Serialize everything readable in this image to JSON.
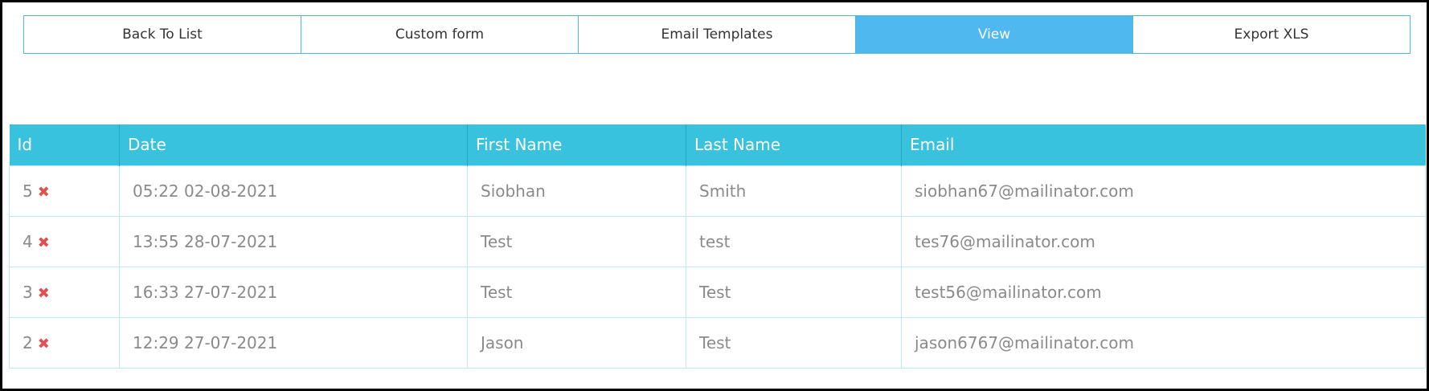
{
  "tabs": [
    {
      "label": "Back To List"
    },
    {
      "label": "Custom form"
    },
    {
      "label": "Email Templates"
    },
    {
      "label": "View",
      "active": true
    },
    {
      "label": "Export XLS"
    }
  ],
  "table": {
    "headers": [
      "Id",
      "Date",
      "First Name",
      "Last Name",
      "Email"
    ],
    "rows": [
      {
        "id": "5",
        "date": "05:22 02-08-2021",
        "first": "Siobhan",
        "last": "Smith",
        "email": "siobhan67@mailinator.com"
      },
      {
        "id": "4",
        "date": "13:55 28-07-2021",
        "first": "Test",
        "last": "test",
        "email": "tes76@mailinator.com"
      },
      {
        "id": "3",
        "date": "16:33 27-07-2021",
        "first": "Test",
        "last": "Test",
        "email": "test56@mailinator.com"
      },
      {
        "id": "2",
        "date": "12:29 27-07-2021",
        "first": "Jason",
        "last": "Test",
        "email": "jason6767@mailinator.com"
      }
    ],
    "delete_icon": "close-icon"
  },
  "colors": {
    "accent": "#39c2dd",
    "active_tab": "#4fb8ee",
    "delete": "#e05050"
  }
}
